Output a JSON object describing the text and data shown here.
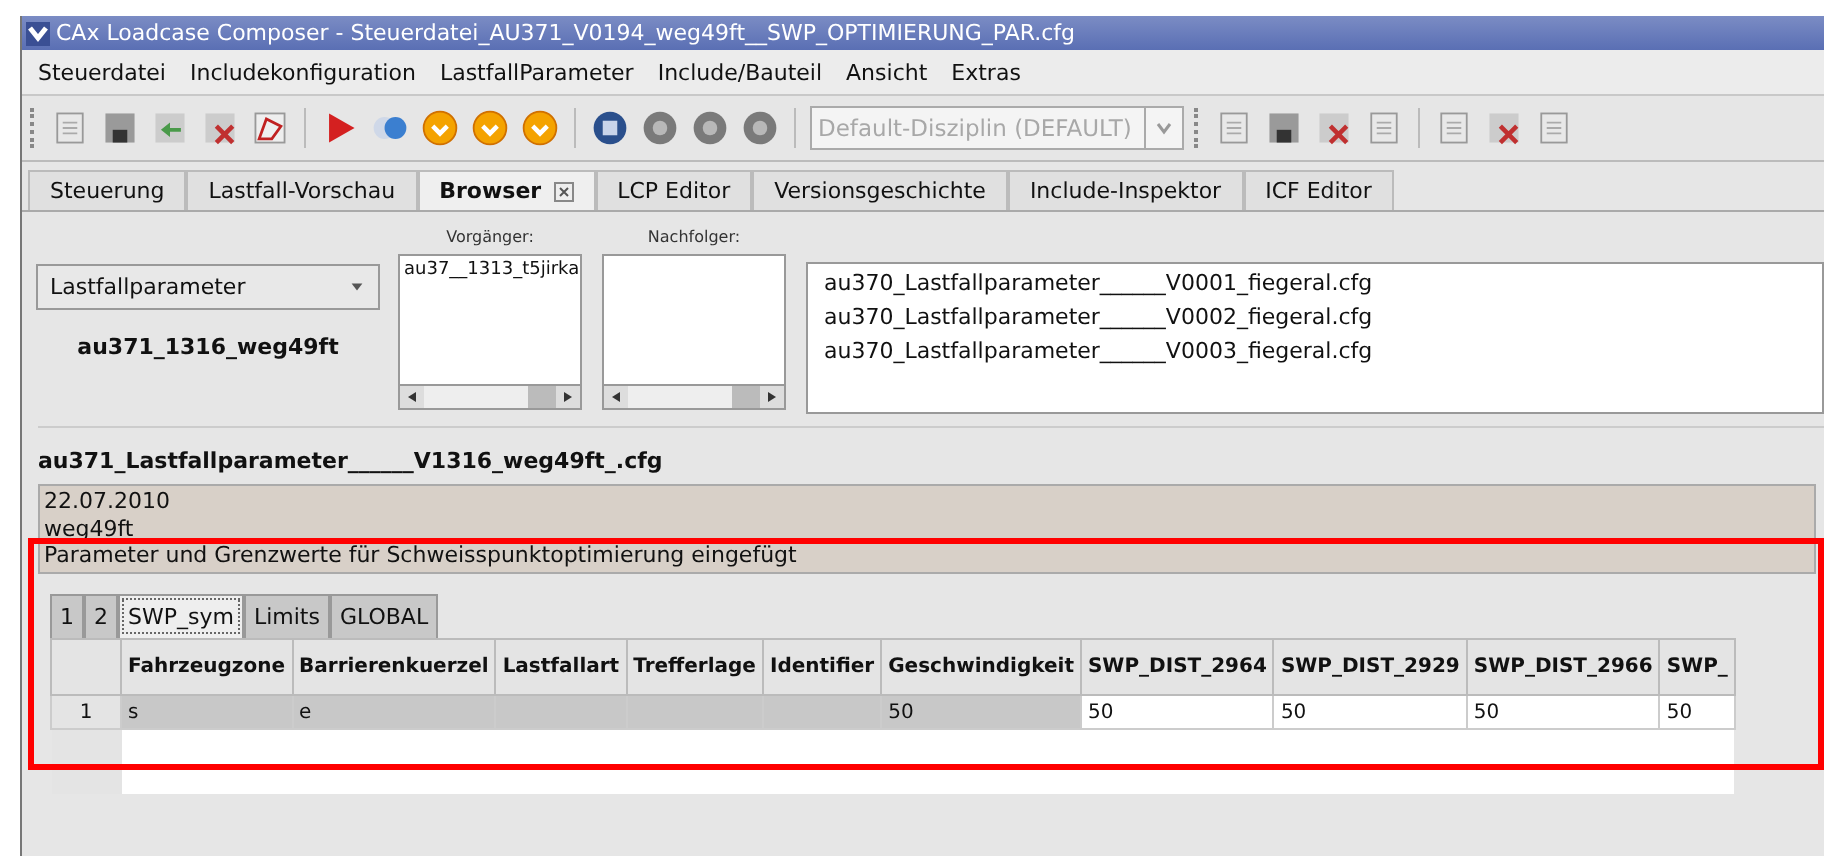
{
  "window": {
    "title": "CAx Loadcase Composer - Steuerdatei_AU371_V0194_weg49ft__SWP_OPTIMIERUNG_PAR.cfg"
  },
  "menu": [
    "Steuerdatei",
    "Includekonfiguration",
    "LastfallParameter",
    "Include/Bauteil",
    "Ansicht",
    "Extras"
  ],
  "toolbar": {
    "discipline": {
      "value": "Default-Disziplin (DEFAULT)",
      "disabled": true
    }
  },
  "tabs": [
    {
      "label": "Steuerung",
      "selected": false,
      "closable": false
    },
    {
      "label": "Lastfall-Vorschau",
      "selected": false,
      "closable": false
    },
    {
      "label": "Browser",
      "selected": true,
      "closable": true
    },
    {
      "label": "LCP Editor",
      "selected": false,
      "closable": false
    },
    {
      "label": "Versionsgeschichte",
      "selected": false,
      "closable": false
    },
    {
      "label": "Include-Inspektor",
      "selected": false,
      "closable": false
    },
    {
      "label": "ICF Editor",
      "selected": false,
      "closable": false
    }
  ],
  "browser": {
    "type_select": "Lastfallparameter",
    "current": "au371_1316_weg49ft",
    "predecessor": {
      "label": "Vorgänger:",
      "items": [
        "au37__1313_t5jirka"
      ]
    },
    "successor": {
      "label": "Nachfolger:"
    },
    "files": [
      "au370_Lastfallparameter______V0001_fiegeral.cfg",
      "au370_Lastfallparameter______V0002_fiegeral.cfg",
      "au370_Lastfallparameter______V0003_fiegeral.cfg"
    ]
  },
  "detail": {
    "filename": "au371_Lastfallparameter______V1316_weg49ft_.cfg",
    "date": "22.07.2010",
    "comment_lines": [
      "weg49ft",
      "Parameter und Grenzwerte für Schweisspunktoptimierung eingefügt"
    ]
  },
  "sheet_tabs": [
    {
      "label": "1",
      "selected": false
    },
    {
      "label": "2",
      "selected": false
    },
    {
      "label": "SWP_sym",
      "selected": true
    },
    {
      "label": "Limits",
      "selected": false
    },
    {
      "label": "GLOBAL",
      "selected": false
    }
  ],
  "table": {
    "columns": [
      {
        "label": "Fahrzeugzone",
        "editable": false
      },
      {
        "label": "Barrierenkuerzel",
        "editable": false
      },
      {
        "label": "Lastfallart",
        "editable": false
      },
      {
        "label": "Trefferlage",
        "editable": false
      },
      {
        "label": "Identifier",
        "editable": false
      },
      {
        "label": "Geschwindigkeit",
        "editable": false
      },
      {
        "label": "SWP_DIST_2964",
        "editable": true
      },
      {
        "label": "SWP_DIST_2929",
        "editable": true
      },
      {
        "label": "SWP_DIST_2966",
        "editable": true
      },
      {
        "label": "SWP_",
        "editable": true
      }
    ],
    "rows": [
      {
        "number": "1",
        "cells": [
          "s",
          "e",
          null,
          null,
          null,
          "50",
          "50",
          "50",
          "50",
          "50"
        ]
      }
    ]
  }
}
